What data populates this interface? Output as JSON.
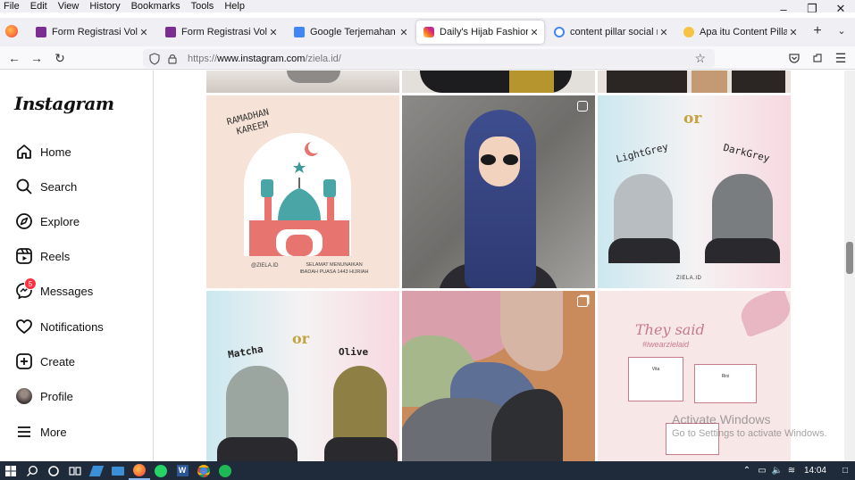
{
  "menu": [
    "File",
    "Edit",
    "View",
    "History",
    "Bookmarks",
    "Tools",
    "Help"
  ],
  "tabs": [
    {
      "label": "Form Registrasi Volunteer Ja",
      "color": "#7a2e8f"
    },
    {
      "label": "Form Registrasi Volunteer Ja",
      "color": "#7a2e8f"
    },
    {
      "label": "Google Terjemahan",
      "color": "#4285f4"
    },
    {
      "label": "Daily's Hijab Fashion (@ziel",
      "color": "#d6249f"
    },
    {
      "label": "content pillar social media -",
      "color": "#ffffff"
    },
    {
      "label": "Apa itu Content Pillar? Peng",
      "color": "#f6c343"
    }
  ],
  "url": {
    "scheme": "https://",
    "host": "www.instagram.com",
    "path": "/ziela.id/"
  },
  "sidebar": {
    "logo": "Instagram",
    "items": [
      {
        "label": "Home",
        "icon": "home-icon"
      },
      {
        "label": "Search",
        "icon": "search-icon"
      },
      {
        "label": "Explore",
        "icon": "compass-icon"
      },
      {
        "label": "Reels",
        "icon": "reels-icon"
      },
      {
        "label": "Messages",
        "icon": "messenger-icon",
        "badge": "5"
      },
      {
        "label": "Notifications",
        "icon": "heart-icon"
      },
      {
        "label": "Create",
        "icon": "plus-square-icon"
      },
      {
        "label": "Profile",
        "icon": "avatar"
      },
      {
        "label": "More",
        "icon": "hamburger-icon"
      }
    ]
  },
  "posts": {
    "ramadhan": {
      "line1": "RAMADHAN",
      "line2": "KAREEM",
      "handle": "@ZIELA.ID",
      "msg1": "SELAMAT MENUNAIKAN",
      "msg2": "IBADAH PUASA 1443 HIJRIAH"
    },
    "grey": {
      "left": "LightGrey",
      "or": "or",
      "right": "DarkGrey",
      "handle": "ZIELA.ID"
    },
    "matcha": {
      "left": "Matcha",
      "or": "or",
      "right": "Olive"
    },
    "said": {
      "title": "They said",
      "tag": "#iwearzielaid",
      "n1": "Vita",
      "n2": "Rini"
    }
  },
  "watermark": {
    "title": "Activate Windows",
    "subtitle": "Go to Settings to activate Windows."
  },
  "clock": "14:04"
}
